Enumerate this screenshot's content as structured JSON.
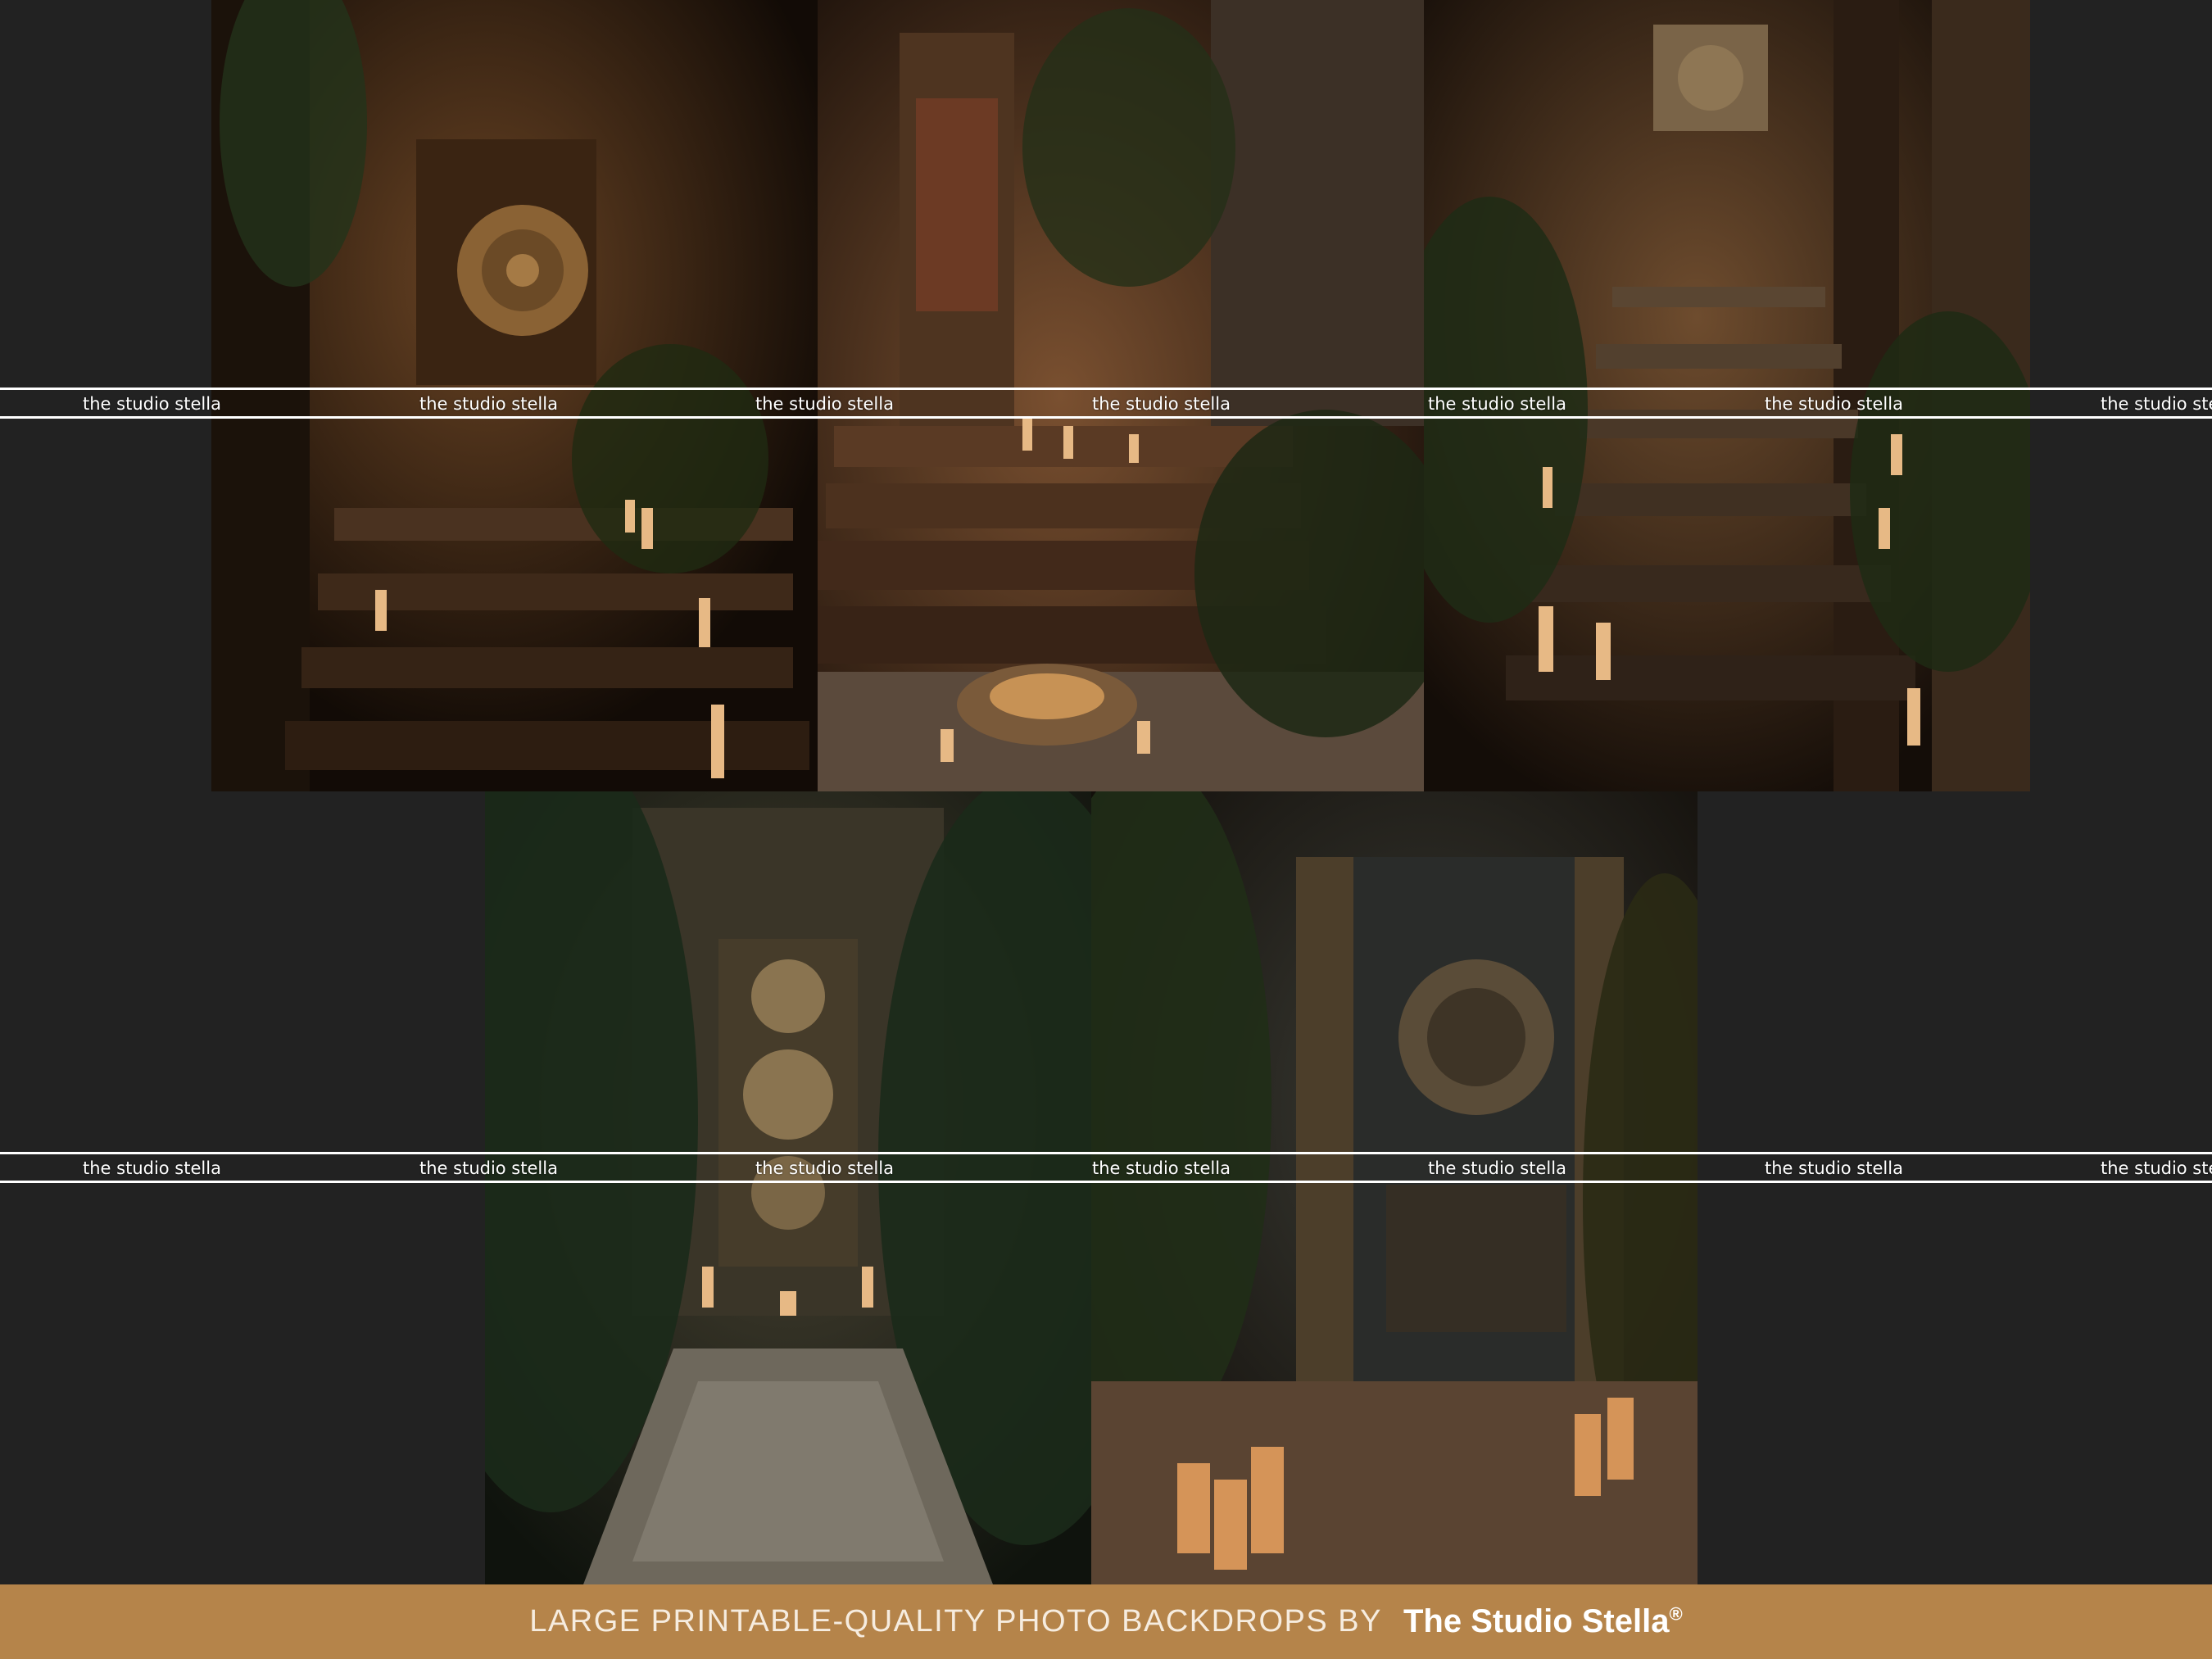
{
  "watermark": {
    "text": "the studio stella",
    "color": "#ffffff"
  },
  "footer": {
    "tagline": "LARGE PRINTABLE-QUALITY PHOTO BACKDROPS BY",
    "brand": "The Studio Stella",
    "brand_mark": "®",
    "background_color": "#b5844a"
  },
  "photos": [
    {
      "subject": "carved temple doorway with candlelit stone steps"
    },
    {
      "subject": "stone staircase with candles and golden bowl"
    },
    {
      "subject": "jungle temple staircase lined with candles"
    },
    {
      "subject": "ornate carved stone door with patterned tile path"
    },
    {
      "subject": "dark temple door with carved medallion and candles"
    }
  ],
  "page_background": "#222222"
}
